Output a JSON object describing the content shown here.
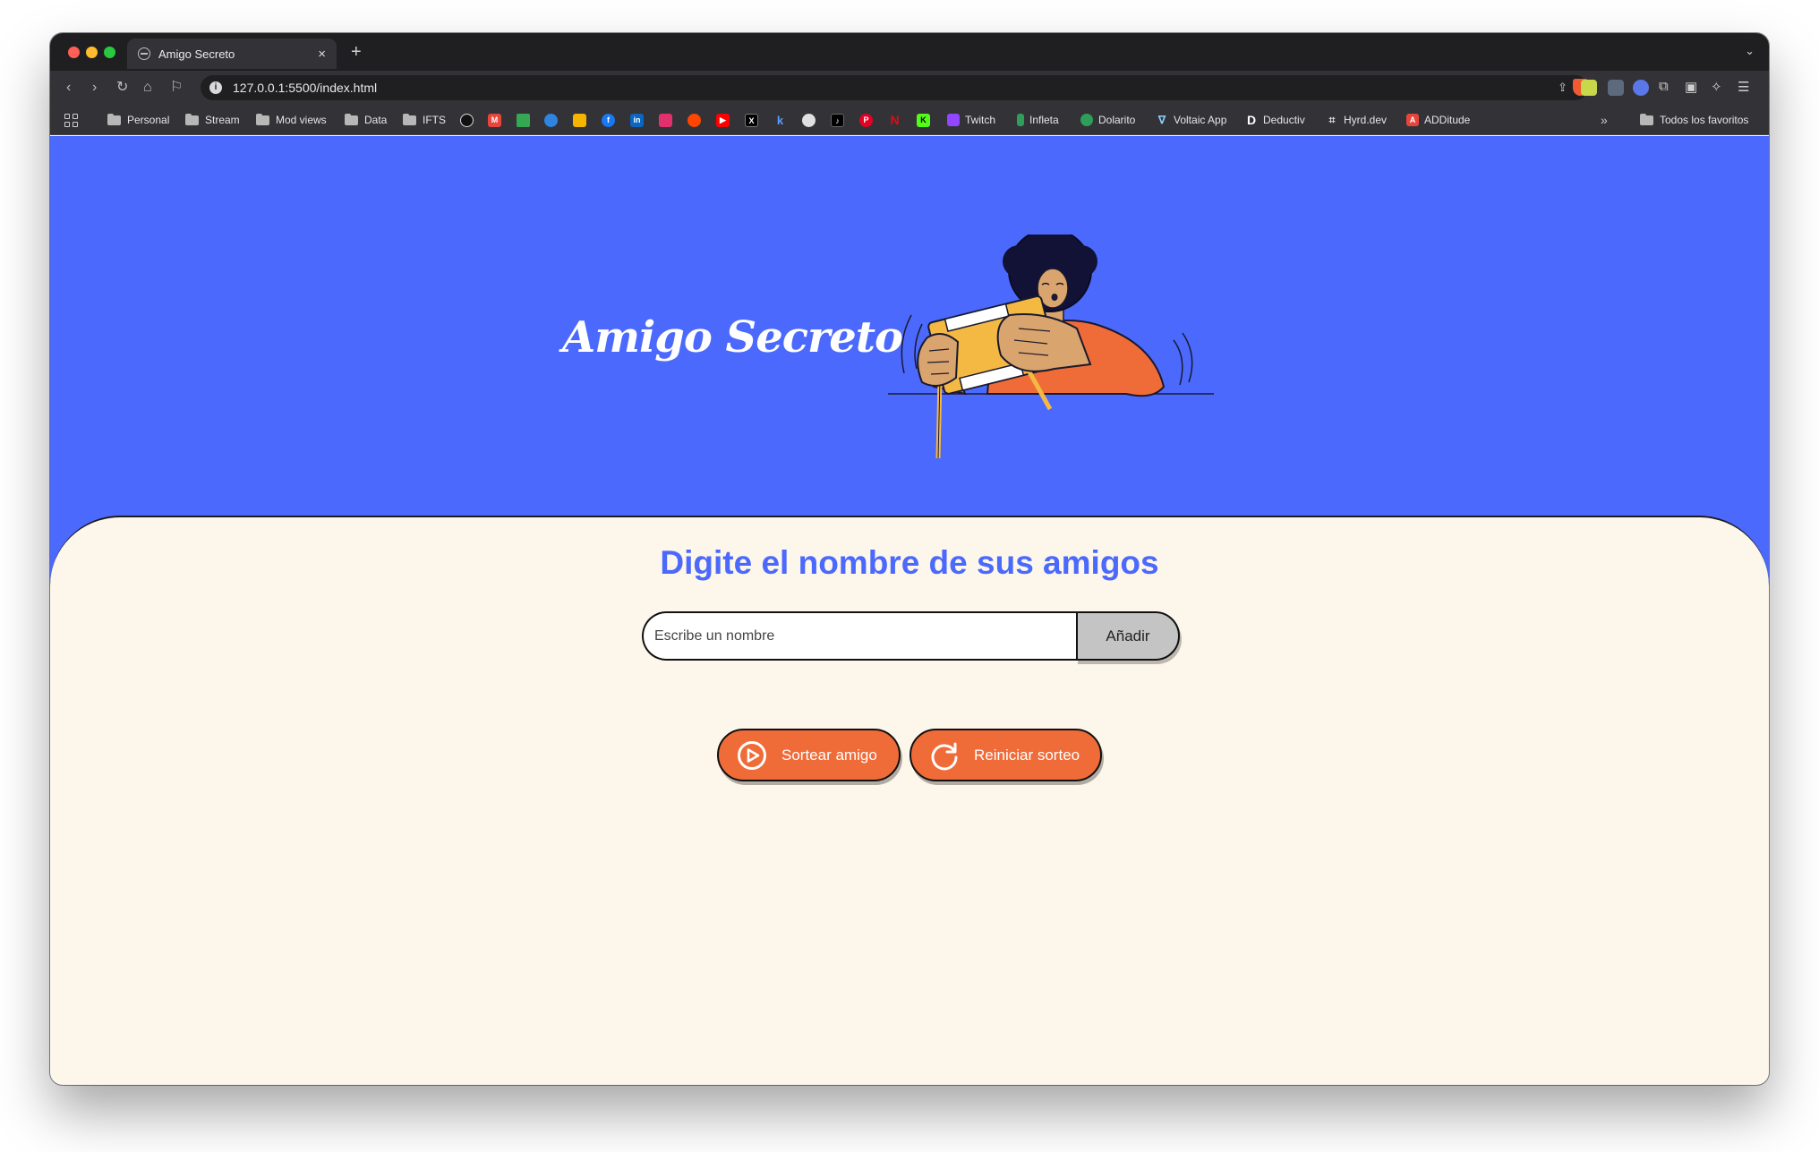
{
  "browser": {
    "tab_title": "Amigo Secreto",
    "tab_close": "×",
    "new_tab": "+",
    "url": "127.0.0.1:5500/index.html"
  },
  "bookmarks": {
    "folders": [
      "Personal",
      "Stream",
      "Mod views",
      "Data",
      "IFTS"
    ],
    "labeled": {
      "twitch": "Twitch",
      "infleta": "Infleta",
      "dolarito": "Dolarito",
      "voltaic": "Voltaic App",
      "deductiv": "Deductiv",
      "hyrd": "Hyrd.dev",
      "additude": "ADDitude"
    },
    "overflow": "»",
    "all_bookmarks": "Todos los favoritos"
  },
  "hero": {
    "title": "Amigo Secreto"
  },
  "form": {
    "heading": "Digite el nombre de sus amigos",
    "input_placeholder": "Escribe un nombre",
    "add_label": "Añadir"
  },
  "actions": {
    "draw_label": "Sortear amigo",
    "reset_label": "Reiniciar sorteo"
  },
  "colors": {
    "hero_bg": "#4b69fd",
    "content_bg": "#fdf6ea",
    "accent_orange": "#ef6b38",
    "add_button_bg": "#c4c4c4"
  },
  "icons": {
    "draw": "play-circle-icon",
    "reset": "refresh-icon"
  }
}
